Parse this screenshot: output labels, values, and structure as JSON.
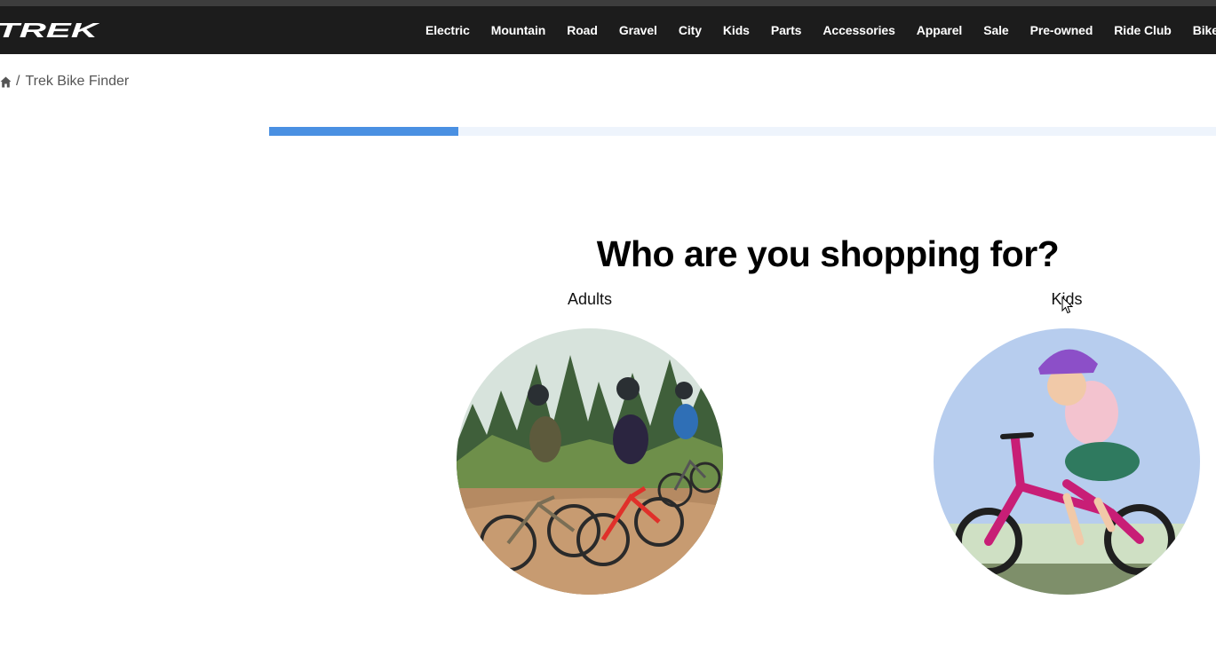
{
  "header": {
    "logo_text": "TREK",
    "nav_items": [
      "Electric",
      "Mountain",
      "Road",
      "Gravel",
      "City",
      "Kids",
      "Parts",
      "Accessories",
      "Apparel",
      "Sale",
      "Pre-owned",
      "Ride Club",
      "Bike Shops"
    ]
  },
  "breadcrumb": {
    "home_icon": "home-icon",
    "separator": "/",
    "current": "Trek Bike Finder"
  },
  "progress": {
    "fraction": 0.2,
    "fill_color": "#4a90e2",
    "track_color": "#eef4fc"
  },
  "main": {
    "heading": "Who are you shopping for?",
    "options": [
      {
        "label": "Adults",
        "image": "adults-riding-gravel-bikes-photo"
      },
      {
        "label": "Kids",
        "image": "child-riding-pink-bike-photo"
      }
    ]
  },
  "colors": {
    "nav_bg": "#1c1c1c",
    "accent": "#4a90e2"
  }
}
